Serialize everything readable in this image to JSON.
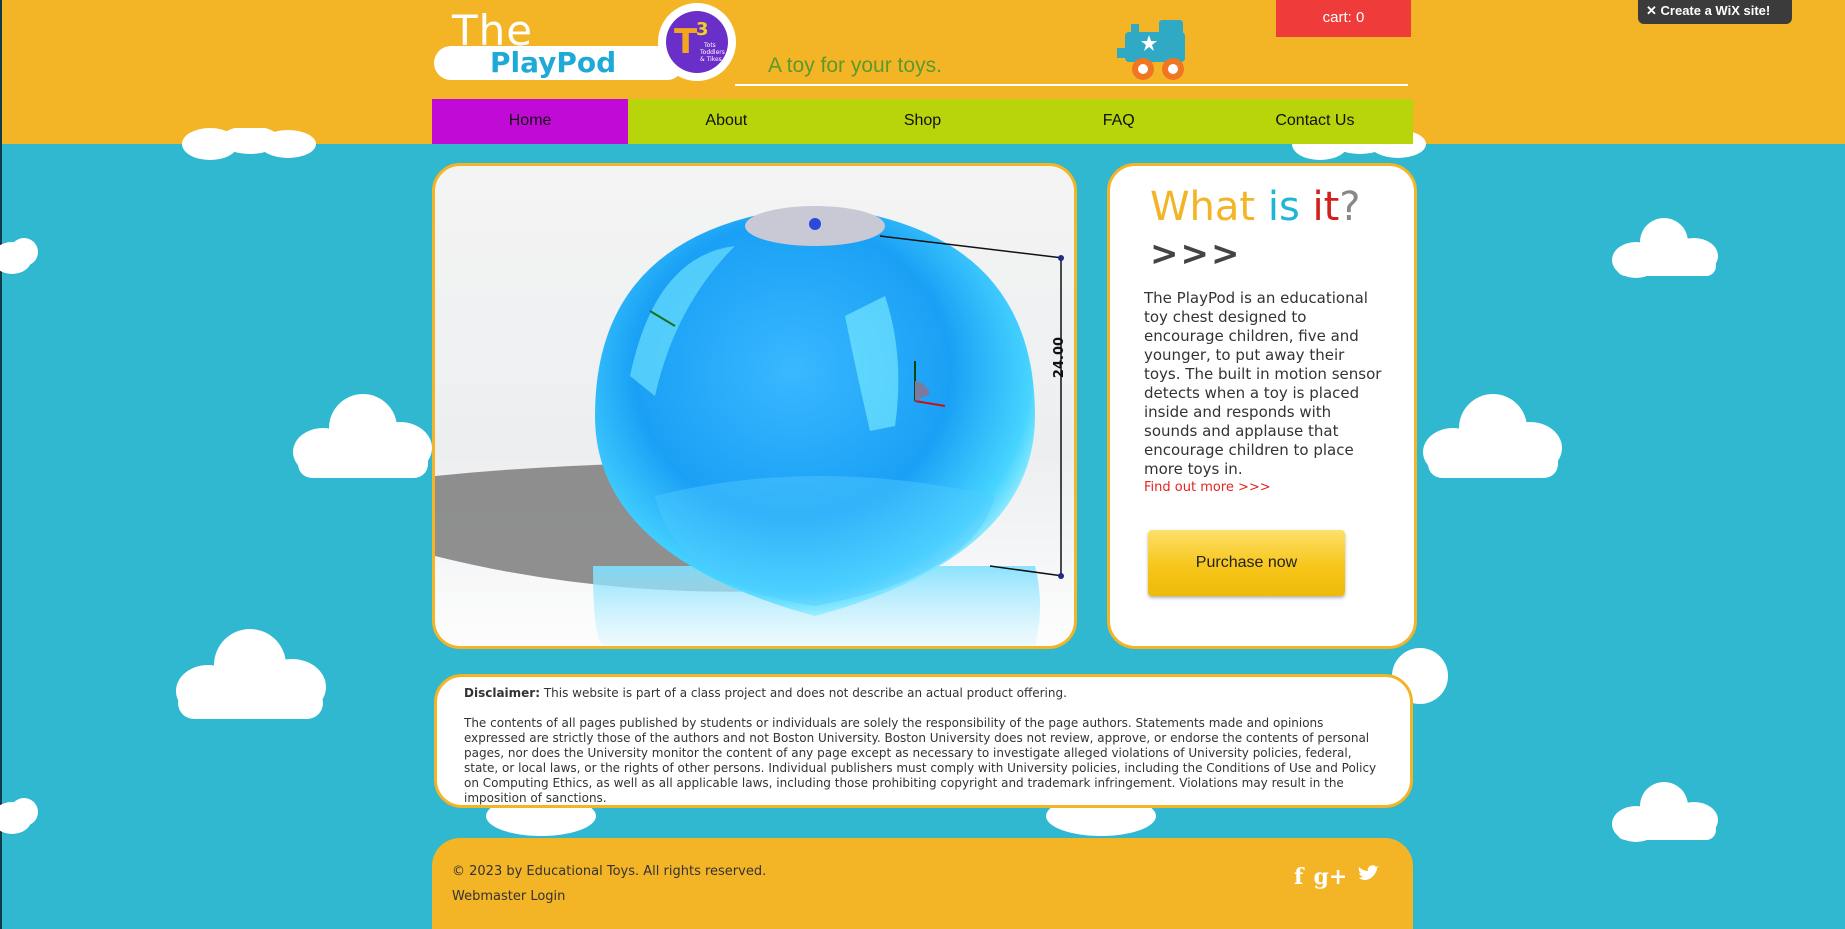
{
  "brand": {
    "the": "The",
    "name": "PlayPod",
    "badge_symbol": "T3",
    "badge_text": "Tots Toddlers & Tikes",
    "tagline": "A toy for your toys."
  },
  "cart": {
    "label": "cart: 0"
  },
  "wix": {
    "label": "Create a WiX site!"
  },
  "nav": {
    "items": [
      {
        "label": "Home",
        "active": true
      },
      {
        "label": "About",
        "active": false
      },
      {
        "label": "Shop",
        "active": false
      },
      {
        "label": "FAQ",
        "active": false
      },
      {
        "label": "Contact Us",
        "active": false
      }
    ]
  },
  "hero": {
    "dimension_label": "24.00"
  },
  "info": {
    "title_what": "What",
    "title_is": "is",
    "title_it": "it",
    "title_q": "?",
    "chevrons": ">>>",
    "description": "The PlayPod is an educational toy chest designed to encourage children, five and younger, to put away their toys. The built in motion sensor detects when a toy is placed inside and responds with sounds and applause that encourage children to place more toys in.",
    "find_out": "Find out more >>>",
    "purchase": "Purchase now"
  },
  "disclaimer": {
    "label": "Disclaimer:",
    "short": "This website is part of a class project and does not describe an actual product offering.",
    "body": "The contents of all pages published by students or individuals are solely the responsibility of the page authors. Statements made and opinions expressed are strictly those of the authors and not Boston University. Boston University does not review, approve, or endorse the contents of personal pages, nor does the University monitor the content of any page except as necessary to investigate alleged violations of University policies, federal, state, or local laws, or the rights of other persons. Individual publishers must comply with University policies, including the Conditions of Use and Policy on Computing Ethics, as well as all applicable laws, including those prohibiting copyright and trademark infringement. Violations may result in the imposition of sanctions."
  },
  "footer": {
    "copyright": "© 2023 by Educational Toys. All rights reserved.",
    "webmaster": "Webmaster Login",
    "social": [
      {
        "icon": "facebook-icon",
        "glyph": "f"
      },
      {
        "icon": "google-plus-icon",
        "glyph": "g+"
      },
      {
        "icon": "twitter-icon",
        "glyph": "t"
      }
    ]
  },
  "colors": {
    "header": "#f3b426",
    "sky": "#2fb8cf",
    "nav": "#b8d40a",
    "nav_active": "#c10ad6",
    "cart": "#ef3b39",
    "accent_blue": "#1fa9d6",
    "accent_red": "#e5241e"
  }
}
